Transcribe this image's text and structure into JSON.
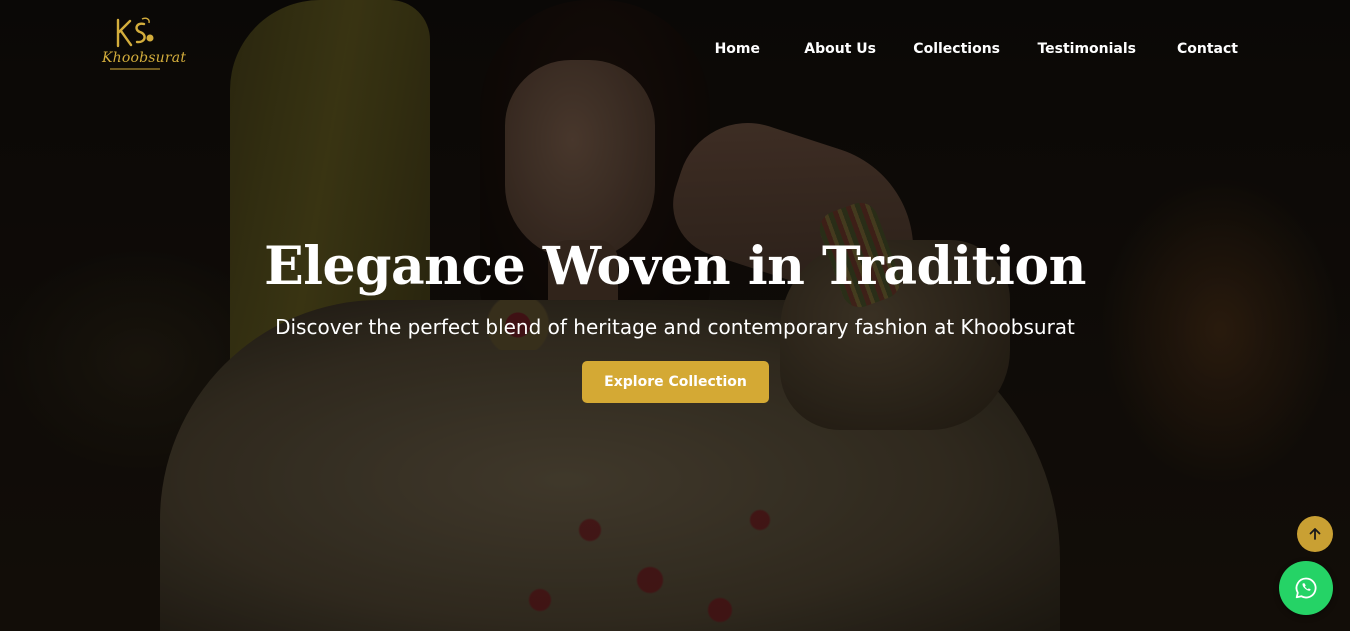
{
  "brand": {
    "name": "Khoobsurat",
    "logo_monogram": "KS",
    "accent_color": "#d4a934"
  },
  "nav": {
    "items": [
      {
        "label": "Home"
      },
      {
        "label": "About Us"
      },
      {
        "label": "Collections"
      },
      {
        "label": "Testimonials"
      },
      {
        "label": "Contact"
      }
    ]
  },
  "hero": {
    "title": "Elegance Woven in Tradition",
    "subtitle": "Discover the perfect blend of heritage and contemporary fashion at Khoobsurat",
    "cta_label": "Explore Collection"
  },
  "floating": {
    "scroll_top_icon": "arrow-up-icon",
    "whatsapp_icon": "whatsapp-icon",
    "whatsapp_color": "#25d366"
  }
}
